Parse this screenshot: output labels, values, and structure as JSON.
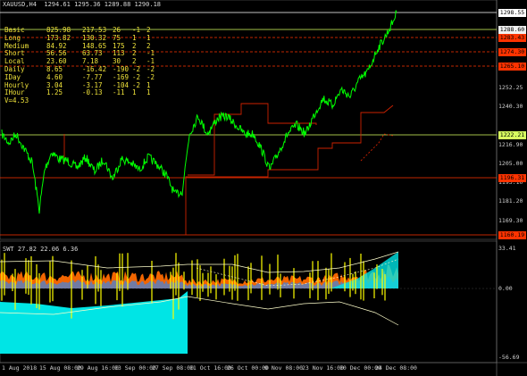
{
  "chart": {
    "header": "XAUUSD,H4  1294.61 1295.36 1289.88 1290.18",
    "stats_rows": [
      [
        "Basic",
        "825.98",
        "217.53",
        "26",
        "-1",
        "2"
      ],
      [
        "Long",
        "173.82",
        "130.32",
        "75",
        "1",
        "1"
      ],
      [
        "Medium",
        "84.92",
        "148.65",
        "175",
        "2",
        "2"
      ],
      [
        "Short",
        "56.56",
        "63.73",
        "113",
        "2",
        "-1"
      ],
      [
        "Local",
        "23.60",
        "7.18",
        "30",
        "2",
        "-1"
      ],
      [
        "Daily",
        "8.65",
        "-16.42",
        "-190",
        "-2",
        "-2"
      ],
      [
        "IDay",
        "4.60",
        "-7.77",
        "-169",
        "-2",
        "-2"
      ],
      [
        "Hourly",
        "3.04",
        "-3.17",
        "-104",
        "-2",
        "1"
      ],
      [
        "IHour",
        "1.25",
        "-0.13",
        "-11",
        "1",
        "1"
      ]
    ],
    "v_label": "V=4.53",
    "price_ticks": [
      "1264.81",
      "1252.25",
      "1240.30",
      "1216.90",
      "1205.00",
      "1193.10",
      "1181.20",
      "1169.30"
    ],
    "price_tags": [
      {
        "text": "1298.55",
        "bg": "#ffffff",
        "fg": "#000000"
      },
      {
        "text": "1288.60",
        "bg": "#f0f0f0",
        "fg": "#000000"
      },
      {
        "text": "1283.43",
        "bg": "#ff3300",
        "fg": "#000000"
      },
      {
        "text": "1274.30",
        "bg": "#ff3300",
        "fg": "#000000"
      },
      {
        "text": "1265.10",
        "bg": "#ff3300",
        "fg": "#000000"
      },
      {
        "text": "1222.21",
        "bg": "#d8ff60",
        "fg": "#000000"
      },
      {
        "text": "1196.31",
        "bg": "#ff3300",
        "fg": "#000000"
      },
      {
        "text": "1160.19",
        "bg": "#ff3300",
        "fg": "#000000"
      }
    ]
  },
  "subwindow": {
    "header": "SWT 27.82 22.06 6.36",
    "scale_ticks": [
      "33.41",
      "0.00",
      "-56.69"
    ]
  },
  "time_axis": {
    "labels": [
      "1 Aug 2018",
      "15 Aug 08:00",
      "29 Aug 16:00",
      "13 Sep 00:00",
      "27 Sep 08:00",
      "11 Oct 16:00",
      "26 Oct 00:00",
      "9 Nov 08:00",
      "23 Nov 16:00",
      "10 Dec 00:00",
      "24 Dec 08:00"
    ]
  },
  "colors": {
    "price_line": "#00ff00",
    "support": "#ff3300",
    "text": "#f0e33a",
    "cyan": "#00e5e5",
    "yellow": "#ffff00",
    "orange": "#ff6a00",
    "blue": "#5b7fbf"
  }
}
